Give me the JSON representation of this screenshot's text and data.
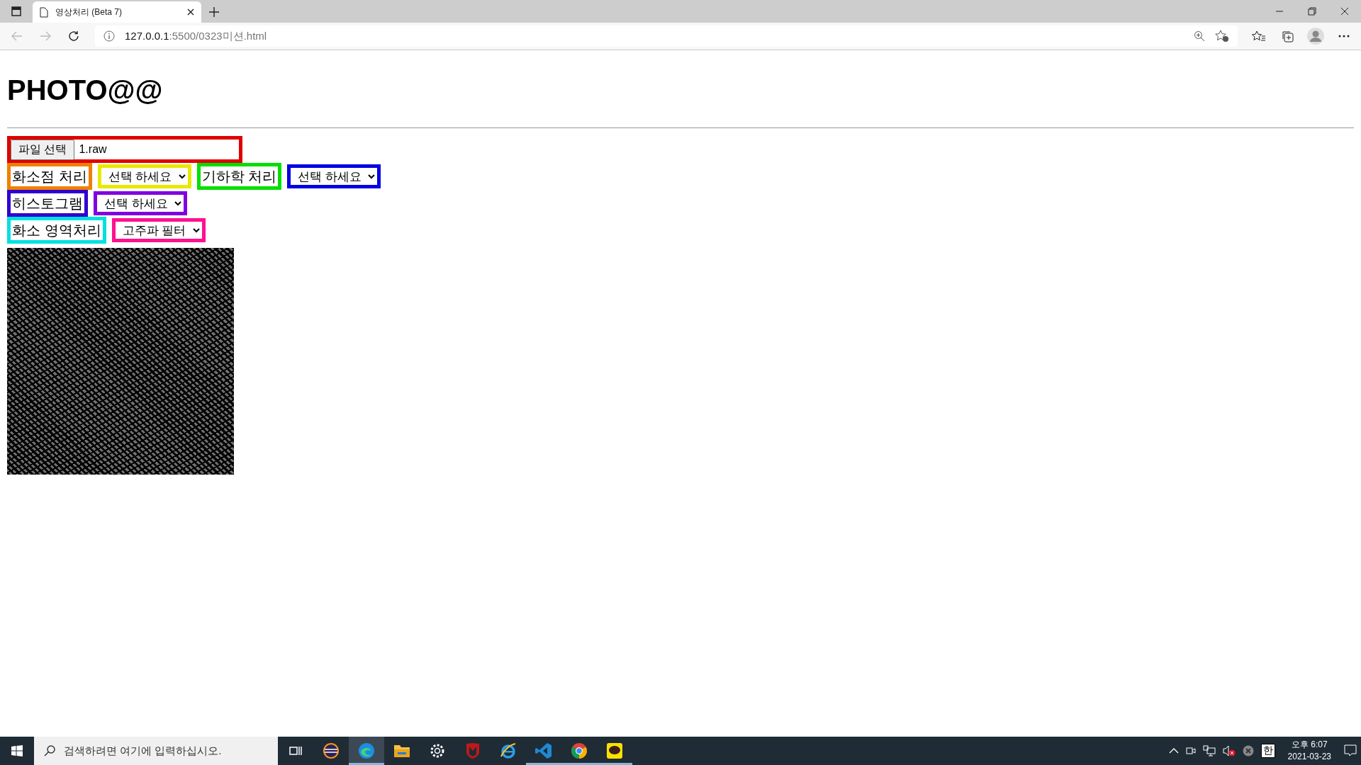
{
  "browser": {
    "tab_title": "영상처리 (Beta 7)",
    "url_host": "127.0.0.1",
    "url_path": ":5500/0323미션.html"
  },
  "page": {
    "heading": "PHOTO@@",
    "file_input": {
      "button": "파일 선택",
      "filename": "1.raw",
      "color": "#e00000"
    },
    "rows": [
      [
        {
          "kind": "label",
          "text": "화소점 처리",
          "color": "#f08000"
        },
        {
          "kind": "select",
          "value": "선택 하세요",
          "color": "#e8e800"
        },
        {
          "kind": "label",
          "text": "기하학 처리",
          "color": "#00e000"
        },
        {
          "kind": "select",
          "value": "선택 하세요",
          "color": "#0000e0"
        }
      ],
      [
        {
          "kind": "label",
          "text": "히스토그램",
          "color": "#3000d0"
        },
        {
          "kind": "select",
          "value": "선택 하세요",
          "color": "#8000e0"
        }
      ],
      [
        {
          "kind": "label",
          "text": "화소 영역처리",
          "color": "#00e0e0"
        },
        {
          "kind": "select",
          "value": "고주파 필터",
          "color": "#ff1090"
        }
      ]
    ]
  },
  "taskbar": {
    "search_placeholder": "검색하려면 여기에 입력하십시오.",
    "apps": [
      {
        "kind": "taskview",
        "selected": false,
        "running": false
      },
      {
        "kind": "eclipse",
        "selected": false,
        "running": false
      },
      {
        "kind": "edge",
        "selected": true,
        "running": true
      },
      {
        "kind": "folder",
        "selected": false,
        "running": false
      },
      {
        "kind": "gear",
        "selected": false,
        "running": false
      },
      {
        "kind": "shield",
        "selected": false,
        "running": false
      },
      {
        "kind": "ie",
        "selected": false,
        "running": false
      },
      {
        "kind": "vscode",
        "selected": false,
        "running": true
      },
      {
        "kind": "chrome",
        "selected": false,
        "running": true
      },
      {
        "kind": "talk",
        "selected": false,
        "running": true
      }
    ],
    "ime": "한",
    "time": "오후 6:07",
    "date": "2021-03-23"
  }
}
